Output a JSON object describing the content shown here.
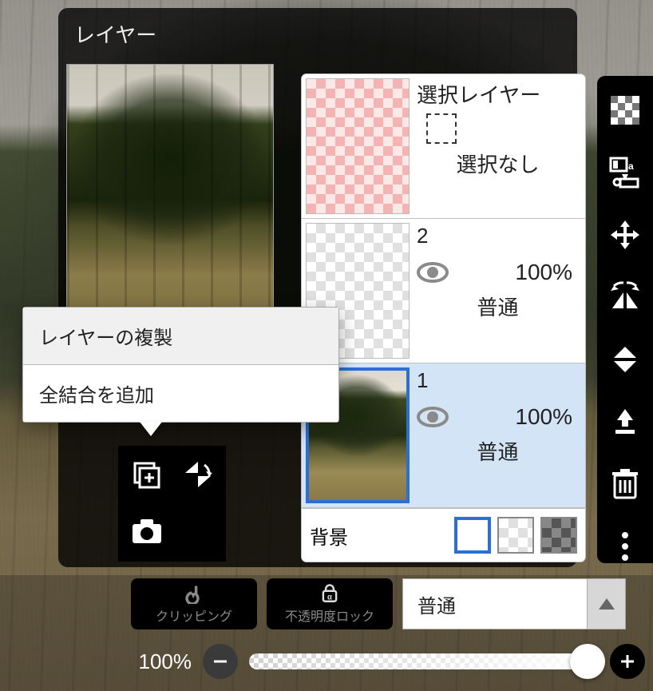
{
  "panel": {
    "title": "レイヤー"
  },
  "layers": [
    {
      "name": "選択レイヤー",
      "status": "選択なし",
      "type": "selection"
    },
    {
      "name": "2",
      "opacity": "100%",
      "blend": "普通",
      "type": "empty"
    },
    {
      "name": "1",
      "opacity": "100%",
      "blend": "普通",
      "type": "photo",
      "selected": true
    }
  ],
  "background": {
    "label": "背景"
  },
  "context_menu": {
    "items": [
      "レイヤーの複製",
      "全結合を追加"
    ]
  },
  "bottom_bar": {
    "clipping_label": "クリッピング",
    "alpha_lock_label": "不透明度ロック",
    "blend_mode": "普通",
    "opacity_text": "100%"
  },
  "icons": {
    "eye": "eye-icon",
    "checker": "checker-icon",
    "reference": "reference-icon",
    "transform": "transform-icon",
    "flip_h": "flip-horizontal-icon",
    "flip_v": "flip-vertical-icon",
    "merge_down": "merge-down-icon",
    "trash": "trash-icon",
    "more": "more-icon",
    "add_layer": "add-layer-icon",
    "camera": "camera-icon",
    "minus": "−",
    "plus": "+"
  }
}
